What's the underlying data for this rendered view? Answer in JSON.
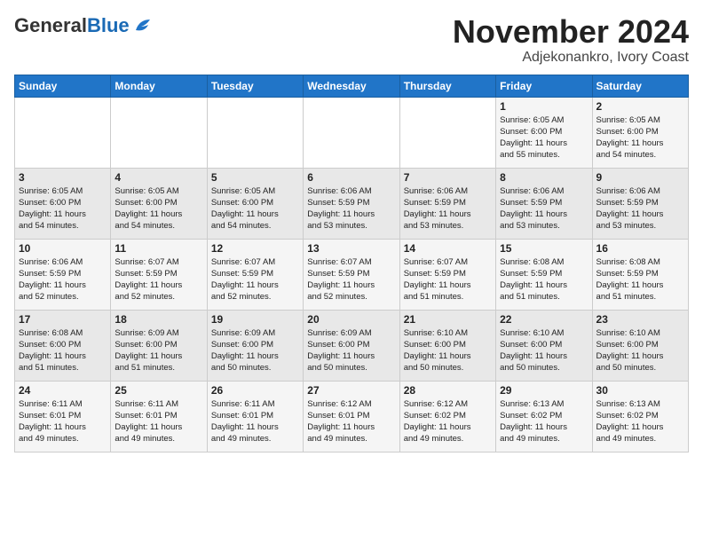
{
  "logo": {
    "general": "General",
    "blue": "Blue"
  },
  "title": "November 2024",
  "subtitle": "Adjekonankro, Ivory Coast",
  "weekdays": [
    "Sunday",
    "Monday",
    "Tuesday",
    "Wednesday",
    "Thursday",
    "Friday",
    "Saturday"
  ],
  "weeks": [
    [
      {
        "day": "",
        "info": ""
      },
      {
        "day": "",
        "info": ""
      },
      {
        "day": "",
        "info": ""
      },
      {
        "day": "",
        "info": ""
      },
      {
        "day": "",
        "info": ""
      },
      {
        "day": "1",
        "info": "Sunrise: 6:05 AM\nSunset: 6:00 PM\nDaylight: 11 hours\nand 55 minutes."
      },
      {
        "day": "2",
        "info": "Sunrise: 6:05 AM\nSunset: 6:00 PM\nDaylight: 11 hours\nand 54 minutes."
      }
    ],
    [
      {
        "day": "3",
        "info": "Sunrise: 6:05 AM\nSunset: 6:00 PM\nDaylight: 11 hours\nand 54 minutes."
      },
      {
        "day": "4",
        "info": "Sunrise: 6:05 AM\nSunset: 6:00 PM\nDaylight: 11 hours\nand 54 minutes."
      },
      {
        "day": "5",
        "info": "Sunrise: 6:05 AM\nSunset: 6:00 PM\nDaylight: 11 hours\nand 54 minutes."
      },
      {
        "day": "6",
        "info": "Sunrise: 6:06 AM\nSunset: 5:59 PM\nDaylight: 11 hours\nand 53 minutes."
      },
      {
        "day": "7",
        "info": "Sunrise: 6:06 AM\nSunset: 5:59 PM\nDaylight: 11 hours\nand 53 minutes."
      },
      {
        "day": "8",
        "info": "Sunrise: 6:06 AM\nSunset: 5:59 PM\nDaylight: 11 hours\nand 53 minutes."
      },
      {
        "day": "9",
        "info": "Sunrise: 6:06 AM\nSunset: 5:59 PM\nDaylight: 11 hours\nand 53 minutes."
      }
    ],
    [
      {
        "day": "10",
        "info": "Sunrise: 6:06 AM\nSunset: 5:59 PM\nDaylight: 11 hours\nand 52 minutes."
      },
      {
        "day": "11",
        "info": "Sunrise: 6:07 AM\nSunset: 5:59 PM\nDaylight: 11 hours\nand 52 minutes."
      },
      {
        "day": "12",
        "info": "Sunrise: 6:07 AM\nSunset: 5:59 PM\nDaylight: 11 hours\nand 52 minutes."
      },
      {
        "day": "13",
        "info": "Sunrise: 6:07 AM\nSunset: 5:59 PM\nDaylight: 11 hours\nand 52 minutes."
      },
      {
        "day": "14",
        "info": "Sunrise: 6:07 AM\nSunset: 5:59 PM\nDaylight: 11 hours\nand 51 minutes."
      },
      {
        "day": "15",
        "info": "Sunrise: 6:08 AM\nSunset: 5:59 PM\nDaylight: 11 hours\nand 51 minutes."
      },
      {
        "day": "16",
        "info": "Sunrise: 6:08 AM\nSunset: 5:59 PM\nDaylight: 11 hours\nand 51 minutes."
      }
    ],
    [
      {
        "day": "17",
        "info": "Sunrise: 6:08 AM\nSunset: 6:00 PM\nDaylight: 11 hours\nand 51 minutes."
      },
      {
        "day": "18",
        "info": "Sunrise: 6:09 AM\nSunset: 6:00 PM\nDaylight: 11 hours\nand 51 minutes."
      },
      {
        "day": "19",
        "info": "Sunrise: 6:09 AM\nSunset: 6:00 PM\nDaylight: 11 hours\nand 50 minutes."
      },
      {
        "day": "20",
        "info": "Sunrise: 6:09 AM\nSunset: 6:00 PM\nDaylight: 11 hours\nand 50 minutes."
      },
      {
        "day": "21",
        "info": "Sunrise: 6:10 AM\nSunset: 6:00 PM\nDaylight: 11 hours\nand 50 minutes."
      },
      {
        "day": "22",
        "info": "Sunrise: 6:10 AM\nSunset: 6:00 PM\nDaylight: 11 hours\nand 50 minutes."
      },
      {
        "day": "23",
        "info": "Sunrise: 6:10 AM\nSunset: 6:00 PM\nDaylight: 11 hours\nand 50 minutes."
      }
    ],
    [
      {
        "day": "24",
        "info": "Sunrise: 6:11 AM\nSunset: 6:01 PM\nDaylight: 11 hours\nand 49 minutes."
      },
      {
        "day": "25",
        "info": "Sunrise: 6:11 AM\nSunset: 6:01 PM\nDaylight: 11 hours\nand 49 minutes."
      },
      {
        "day": "26",
        "info": "Sunrise: 6:11 AM\nSunset: 6:01 PM\nDaylight: 11 hours\nand 49 minutes."
      },
      {
        "day": "27",
        "info": "Sunrise: 6:12 AM\nSunset: 6:01 PM\nDaylight: 11 hours\nand 49 minutes."
      },
      {
        "day": "28",
        "info": "Sunrise: 6:12 AM\nSunset: 6:02 PM\nDaylight: 11 hours\nand 49 minutes."
      },
      {
        "day": "29",
        "info": "Sunrise: 6:13 AM\nSunset: 6:02 PM\nDaylight: 11 hours\nand 49 minutes."
      },
      {
        "day": "30",
        "info": "Sunrise: 6:13 AM\nSunset: 6:02 PM\nDaylight: 11 hours\nand 49 minutes."
      }
    ]
  ]
}
